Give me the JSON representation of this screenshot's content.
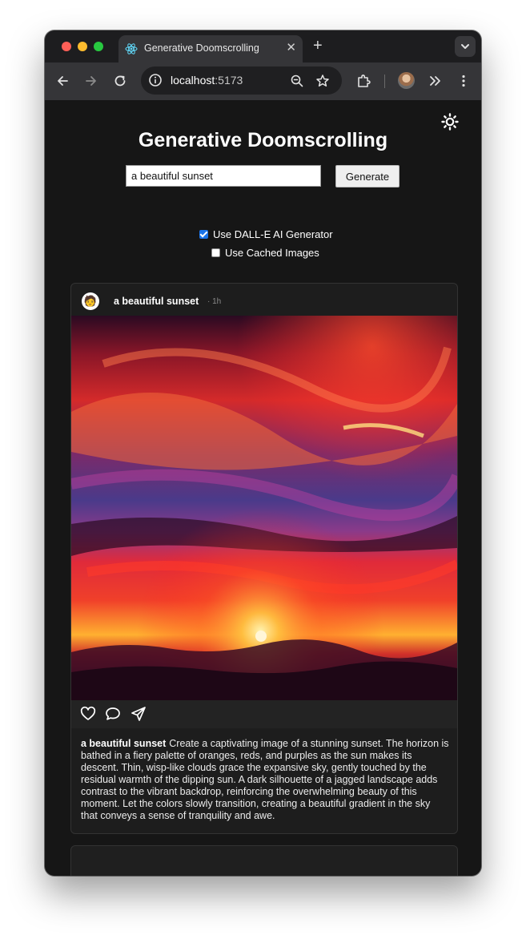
{
  "browser": {
    "tab_title": "Generative Doomscrolling",
    "url_host": "localhost",
    "url_port": ":5173"
  },
  "app": {
    "title": "Generative Doomscrolling",
    "search": {
      "value": "a beautiful sunset"
    },
    "generate_label": "Generate",
    "options": [
      {
        "label": "Use DALL-E AI Generator",
        "checked": true
      },
      {
        "label": "Use Cached Images",
        "checked": false
      }
    ]
  },
  "post": {
    "avatar_emoji": "🧑",
    "username": "a beautiful sunset",
    "time": "· 1h",
    "caption_title": "a beautiful sunset",
    "caption_text": "Create a captivating image of a stunning sunset. The horizon is bathed in a fiery palette of oranges, reds, and purples as the sun makes its descent. Thin, wisp-like clouds grace the expansive sky, gently touched by the residual warmth of the dipping sun. A dark silhouette of a jagged landscape adds contrast to the vibrant backdrop, reinforcing the overwhelming beauty of this moment. Let the colors slowly transition, creating a beautiful gradient in the sky that conveys a sense of tranquility and awe."
  },
  "icons": [
    "close-icon",
    "plus-icon",
    "chevron-down-icon",
    "back-arrow-icon",
    "forward-arrow-icon",
    "reload-icon",
    "info-icon",
    "zoom-icon",
    "star-icon",
    "extensions-icon",
    "overflow-chevrons-icon",
    "more-vert-icon",
    "sun-icon",
    "heart-icon",
    "comment-icon",
    "send-icon"
  ],
  "colors": {
    "page_bg": "#161616",
    "card_bg": "#1d1d1d",
    "checkbox_accent": "#1a73e8"
  }
}
